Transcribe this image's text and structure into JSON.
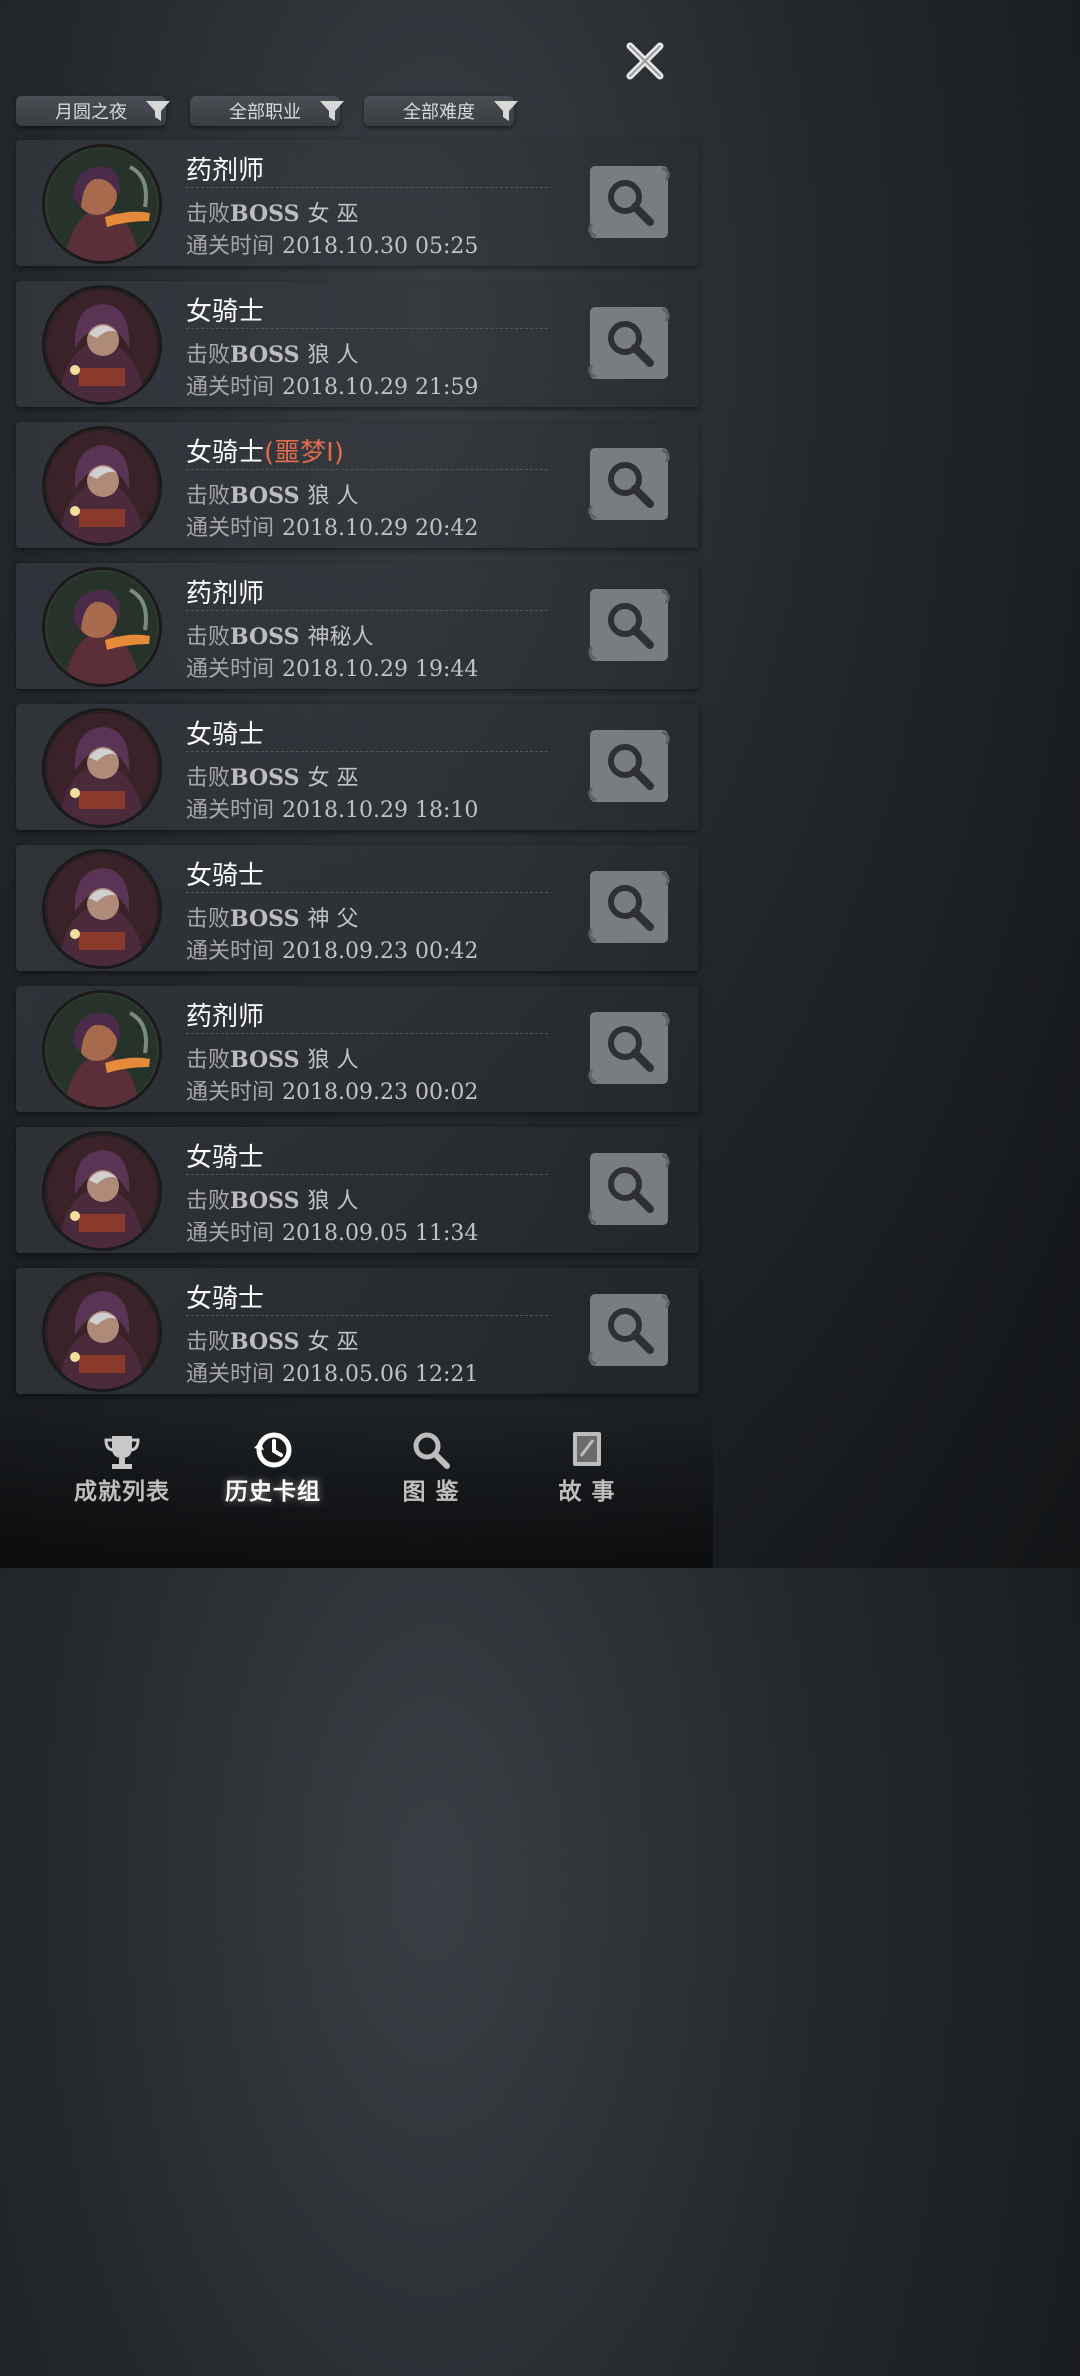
{
  "filters": [
    {
      "label": "月圆之夜"
    },
    {
      "label": "全部职业"
    },
    {
      "label": "全部难度"
    }
  ],
  "labels": {
    "defeat_prefix": "击败",
    "boss": "BOSS",
    "time_prefix": "通关时间"
  },
  "records": [
    {
      "character": "药剂师",
      "tag": "",
      "boss": "女 巫",
      "time": "2018.10.30 05:25",
      "avatar": "alchemist"
    },
    {
      "character": "女骑士",
      "tag": "",
      "boss": "狼 人",
      "time": "2018.10.29 21:59",
      "avatar": "knight"
    },
    {
      "character": "女骑士",
      "tag": "(噩梦I)",
      "boss": "狼 人",
      "time": "2018.10.29 20:42",
      "avatar": "knight"
    },
    {
      "character": "药剂师",
      "tag": "",
      "boss": "神秘人",
      "time": "2018.10.29 19:44",
      "avatar": "alchemist"
    },
    {
      "character": "女骑士",
      "tag": "",
      "boss": "女 巫",
      "time": "2018.10.29 18:10",
      "avatar": "knight"
    },
    {
      "character": "女骑士",
      "tag": "",
      "boss": "神 父",
      "time": "2018.09.23 00:42",
      "avatar": "knight"
    },
    {
      "character": "药剂师",
      "tag": "",
      "boss": "狼 人",
      "time": "2018.09.23 00:02",
      "avatar": "alchemist"
    },
    {
      "character": "女骑士",
      "tag": "",
      "boss": "狼 人",
      "time": "2018.09.05 11:34",
      "avatar": "knight"
    },
    {
      "character": "女骑士",
      "tag": "",
      "boss": "女 巫",
      "time": "2018.05.06 12:21",
      "avatar": "knight"
    }
  ],
  "nav": [
    {
      "label": "成就列表",
      "icon": "trophy-icon",
      "active": false
    },
    {
      "label": "历史卡组",
      "icon": "history-icon",
      "active": true
    },
    {
      "label": "图 鉴",
      "icon": "magnifier-icon",
      "active": false
    },
    {
      "label": "故 事",
      "icon": "book-icon",
      "active": false
    }
  ],
  "colors": {
    "nightmare_tag": "#e06a4e",
    "text_secondary": "#a6a6a6"
  }
}
